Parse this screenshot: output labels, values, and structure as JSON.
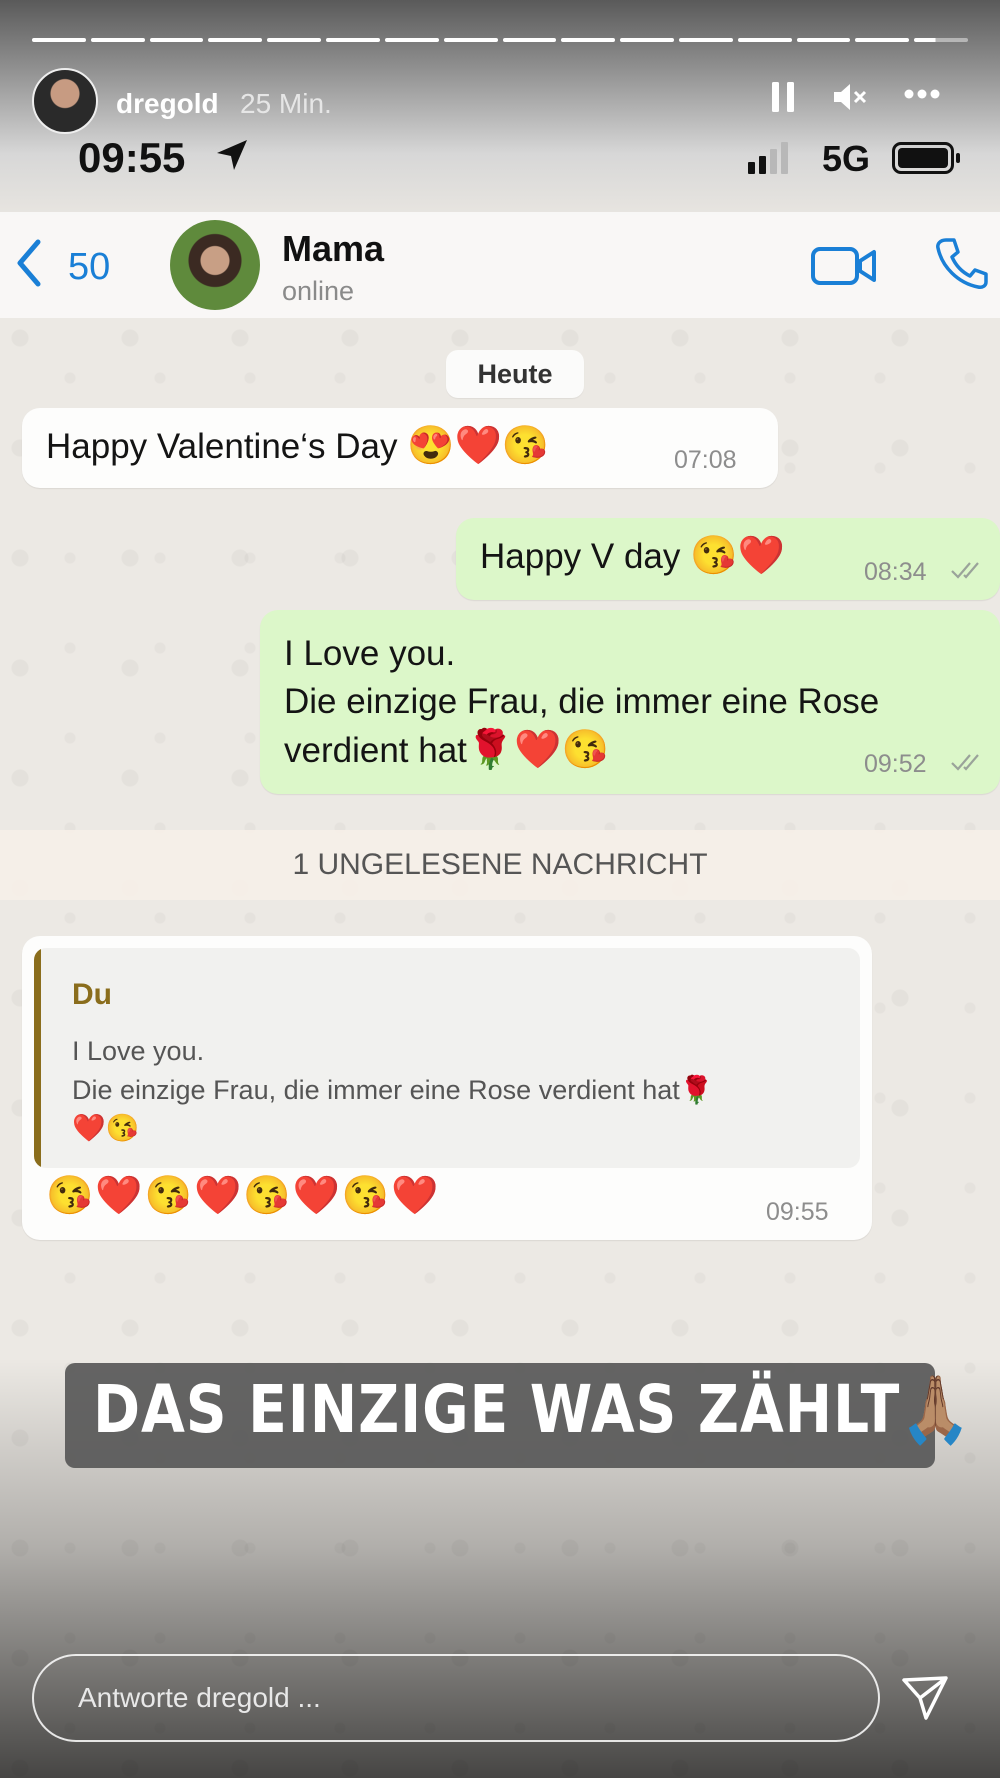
{
  "story": {
    "username": "dregold",
    "time_ago": "25 Min.",
    "segments": 16,
    "reply_placeholder": "Antworte dregold ..."
  },
  "statusbar": {
    "time": "09:55",
    "network": "5G"
  },
  "chat_header": {
    "back_count": "50",
    "contact_name": "Mama",
    "contact_status": "online"
  },
  "chat": {
    "date_chip": "Heute",
    "messages": [
      {
        "direction": "in",
        "text": "Happy Valentine‘s Day",
        "emojis": "😍❤️😘",
        "time": "07:08"
      },
      {
        "direction": "out",
        "text": "Happy V day",
        "emojis": "😘❤️",
        "time": "08:34"
      },
      {
        "direction": "out",
        "lines": [
          "I Love you.",
          "Die einzige Frau, die immer eine Rose",
          "verdient hat"
        ],
        "emojis": "🌹❤️😘",
        "time": "09:52"
      }
    ],
    "unread_banner": "1 UNGELESENE NACHRICHT",
    "reply_message": {
      "quote_author": "Du",
      "quote_lines": [
        "I Love you.",
        "Die einzige Frau, die immer eine Rose verdient hat🌹",
        "❤️😘"
      ],
      "text": "😘❤️😘❤️😘❤️😘❤️",
      "time": "09:55"
    }
  },
  "caption": "DAS EINZIGE WAS ZÄHLT🙏🏽",
  "colors": {
    "wa_blue": "#1a7fd6",
    "out_bubble": "#dcf7c9",
    "quote_accent": "#8a6d1c"
  }
}
